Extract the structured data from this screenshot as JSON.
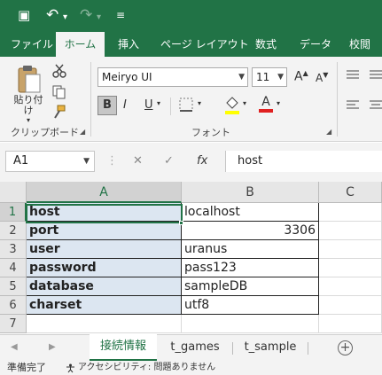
{
  "colors": {
    "accent": "#217346",
    "selected_fill": "#dce6f1"
  },
  "titlebar": {
    "icons": [
      "save-icon",
      "undo-icon",
      "redo-icon",
      "customize-qat-icon"
    ],
    "glyphs": {
      "save": "▣",
      "undo": "↶",
      "undo_dd": "▾",
      "redo": "↷",
      "redo_dd": "▾",
      "customize": "≡"
    }
  },
  "ribbon_tabs": [
    "ファイル",
    "ホーム",
    "挿入",
    "ページ レイアウト",
    "数式",
    "データ",
    "校閲"
  ],
  "ribbon": {
    "clipboard": {
      "paste_label": "貼り付け",
      "paste_dd": "▾",
      "group_label": "クリップボード"
    },
    "font": {
      "font_name": "Meiryo UI",
      "font_size": "11",
      "grow_font": "A",
      "shrink_font": "A",
      "bold": "B",
      "italic": "I",
      "underline": "U",
      "font_color": "A",
      "group_label": "フォント"
    }
  },
  "formula_bar": {
    "name_box": "A1",
    "cancel_glyph": "✕",
    "enter_glyph": "✓",
    "fx_glyph": "fx",
    "formula": "host"
  },
  "grid": {
    "columns": [
      "A",
      "B",
      "C"
    ],
    "rows": [
      {
        "num": "1",
        "a": "host",
        "b": "localhost"
      },
      {
        "num": "2",
        "a": "port",
        "b": "3306"
      },
      {
        "num": "3",
        "a": "user",
        "b": "uranus"
      },
      {
        "num": "4",
        "a": "password",
        "b": "pass123"
      },
      {
        "num": "5",
        "a": "database",
        "b": "sampleDB"
      },
      {
        "num": "6",
        "a": "charset",
        "b": "utf8"
      },
      {
        "num": "7",
        "a": "",
        "b": ""
      }
    ]
  },
  "sheets": [
    "接続情報",
    "t_games",
    "t_sample"
  ],
  "sheet_nav": {
    "prev": "◀",
    "next": "▶",
    "add": "+"
  },
  "status": {
    "ready": "準備完了",
    "accessibility": "アクセシビリティ: 問題ありません"
  }
}
